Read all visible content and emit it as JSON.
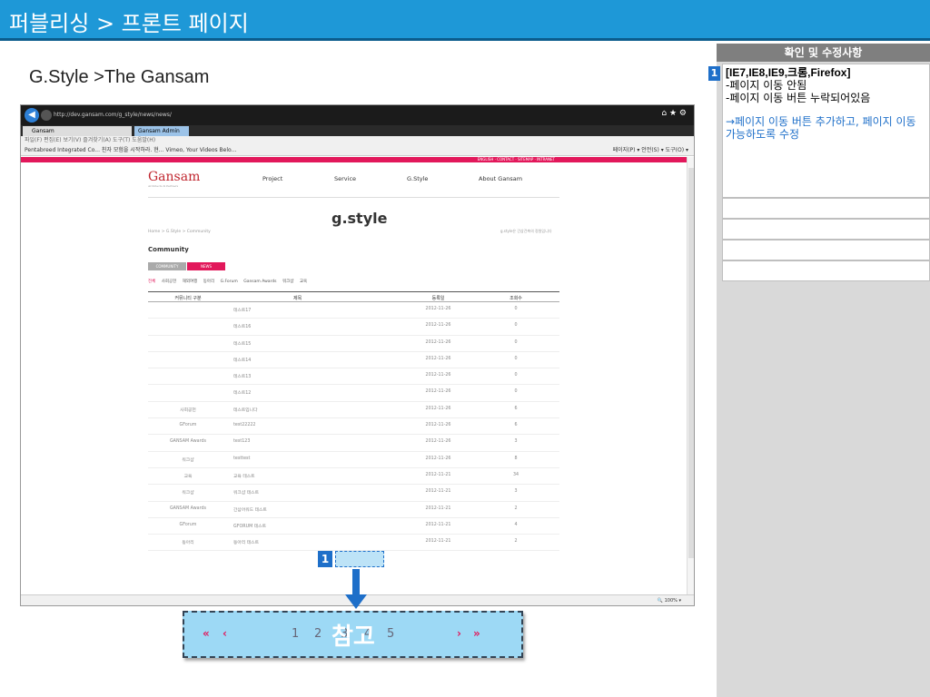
{
  "slide": {
    "title": "퍼블리싱 > 프론트 페이지",
    "subtitle": "G.Style >The Gansam"
  },
  "panel": {
    "header": "확인 및 수정사항",
    "note_number": "1",
    "note_heading": "[IE7,IE8,IE9,크롬,Firefox]",
    "note_lines": [
      "-페이지 이동 안됨",
      "-페이지 이동 버튼 누락되어있음"
    ],
    "note_fix": "→페이지 이동 버튼 추가하고, 페이지 이동 가능하도록 수정"
  },
  "browser": {
    "url": "http://dev.gansam.com/g_style/news/news/",
    "tab_active": "Gansam",
    "tab_other": "Gansam Admin",
    "menu": "파일(F)  편집(E)  보기(V)  즐겨찾기(A)  도구(T)  도움말(H)",
    "favorites": "Pentabreed Integrated Co...  친자 모험을 시작하라. 현...  Vimeo, Your Videos Belo...",
    "toolbar_right": "페이지(P) ▾  안전(S) ▾  도구(O) ▾",
    "zoom": "100%"
  },
  "site": {
    "top_links": "ENGLISH · CONTACT · SITEMAP · INTRANET",
    "logo": "Gansam",
    "logo_sub": "Architects & Partners",
    "nav": [
      "Project",
      "Service",
      "G.Style",
      "About Gansam"
    ],
    "page_title": "g.style",
    "breadcrumb": "Home > G.Style > Community",
    "breadcrumb_right": "g.style은 간삼건축의 정원입니다",
    "section": "Community",
    "tab_community": "COMMUNITY",
    "tab_news": "NEWS",
    "filters": [
      "전체",
      "사회공헌",
      "해외여행",
      "동아리",
      "G.Forum",
      "Gansam Awards",
      "워크샵",
      "교육"
    ],
    "table_headers": [
      "커뮤니티 구분",
      "제목",
      "등록일",
      "조회수"
    ],
    "rows": [
      [
        "",
        "테스트17",
        "2012-11-26",
        "0"
      ],
      [
        "",
        "테스트16",
        "2012-11-26",
        "0"
      ],
      [
        "",
        "테스트15",
        "2012-11-26",
        "0"
      ],
      [
        "",
        "테스트14",
        "2012-11-26",
        "0"
      ],
      [
        "",
        "테스트13",
        "2012-11-26",
        "0"
      ],
      [
        "",
        "테스트12",
        "2012-11-26",
        "0"
      ],
      [
        "사회공헌",
        "테스트입니다",
        "2012-11-26",
        "6"
      ],
      [
        "GForum",
        "test22222",
        "2012-11-26",
        "6"
      ],
      [
        "GANSAM Awards",
        "test123",
        "2012-11-26",
        "3"
      ],
      [
        "워크샵",
        "testtest",
        "2012-11-26",
        "8"
      ],
      [
        "교육",
        "교육 테스트",
        "2012-11-21",
        "34"
      ],
      [
        "워크샵",
        "워크샵 테스트",
        "2012-11-21",
        "3"
      ],
      [
        "GANSAM Awards",
        "간삼어워드 테스트",
        "2012-11-21",
        "2"
      ],
      [
        "GForum",
        "GFORUM 테스트",
        "2012-11-21",
        "4"
      ],
      [
        "동아리",
        "동아리 테스트",
        "2012-11-21",
        "2"
      ]
    ]
  },
  "callout": {
    "badge": "1",
    "first": "«",
    "prev": "‹",
    "pages": [
      "1",
      "2",
      "3",
      "4",
      "5"
    ],
    "next": "›",
    "last": "»",
    "reference": "참고"
  }
}
